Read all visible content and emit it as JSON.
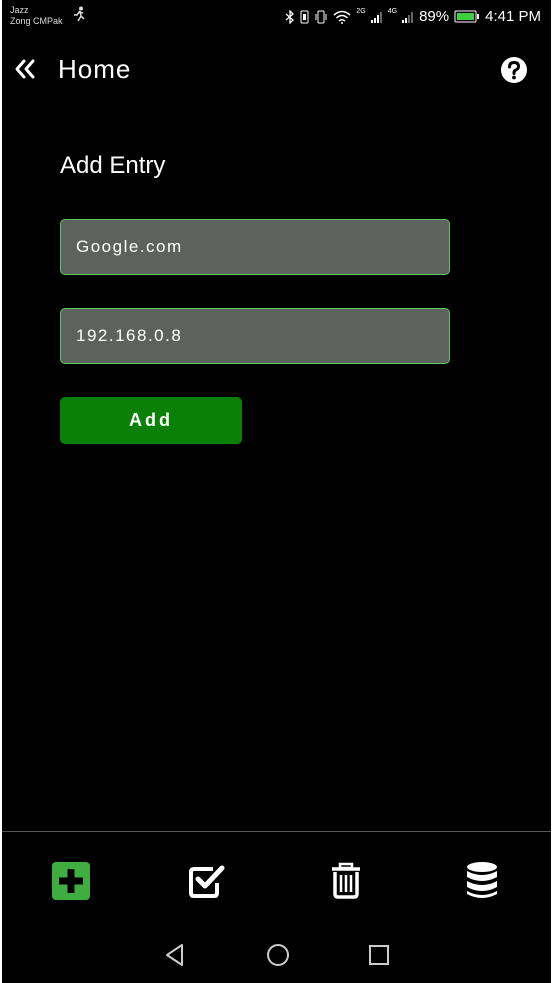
{
  "status_bar": {
    "carrier_1": "Jazz",
    "carrier_2": "Zong CMPak",
    "net_1": "2G",
    "net_2": "4G",
    "battery": "89%",
    "time": "4:41 PM"
  },
  "app_bar": {
    "title": "Home",
    "back_icon": "double-chevron-left-icon",
    "help_icon": "question-circle-icon"
  },
  "form": {
    "heading": "Add Entry",
    "domain_value": "Google.com",
    "ip_value": "192.168.0.8",
    "add_label": "Add"
  },
  "bottom_tabs": [
    {
      "name": "add",
      "icon": "plus-square-icon",
      "active": true
    },
    {
      "name": "check",
      "icon": "check-square-icon",
      "active": false
    },
    {
      "name": "delete",
      "icon": "trash-icon",
      "active": false
    },
    {
      "name": "database",
      "icon": "database-icon",
      "active": false
    }
  ],
  "colors": {
    "background": "#000000",
    "field_bg": "#5d625e",
    "field_border": "#5fc55f",
    "accent_green": "#0a8008",
    "active_tab": "#3fae3f"
  }
}
